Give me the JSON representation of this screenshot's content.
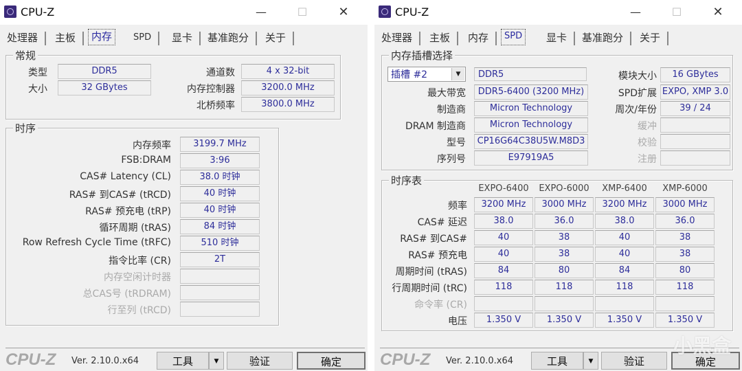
{
  "windows": [
    {
      "title": "CPU-Z",
      "controls": {
        "minimize": "—",
        "maximize": "☐",
        "close": "✕"
      },
      "tabs": [
        {
          "label": "处理器",
          "active": false
        },
        {
          "label": "主板",
          "active": false
        },
        {
          "label": "内存",
          "active": true
        },
        {
          "label": "SPD",
          "active": false
        },
        {
          "label": "显卡",
          "active": false
        },
        {
          "label": "基准跑分",
          "active": false
        },
        {
          "label": "关于",
          "active": false
        }
      ],
      "general": {
        "title": "常规",
        "type_label": "类型",
        "type_value": "DDR5",
        "size_label": "大小",
        "size_value": "32 GBytes",
        "channels_label": "通道数",
        "channels_value": "4 x 32-bit",
        "mc_label": "内存控制器",
        "mc_value": "3200.0 MHz",
        "nb_label": "北桥频率",
        "nb_value": "3800.0 MHz"
      },
      "timings": {
        "title": "时序",
        "rows": [
          {
            "label": "内存频率",
            "value": "3199.7 MHz",
            "disabled": false
          },
          {
            "label": "FSB:DRAM",
            "value": "3:96",
            "disabled": false
          },
          {
            "label": "CAS# Latency (CL)",
            "value": "38.0 时钟",
            "disabled": false
          },
          {
            "label": "RAS# 到CAS# (tRCD)",
            "value": "40 时钟",
            "disabled": false
          },
          {
            "label": "RAS# 预充电 (tRP)",
            "value": "40 时钟",
            "disabled": false
          },
          {
            "label": "循环周期 (tRAS)",
            "value": "84 时钟",
            "disabled": false
          },
          {
            "label": "Row Refresh Cycle Time (tRFC)",
            "value": "510 时钟",
            "disabled": false
          },
          {
            "label": "指令比率 (CR)",
            "value": "2T",
            "disabled": false
          },
          {
            "label": "内存空闲计时器",
            "value": "",
            "disabled": true
          },
          {
            "label": "总CAS号 (tRDRAM)",
            "value": "",
            "disabled": true
          },
          {
            "label": "行至列 (tRCD)",
            "value": "",
            "disabled": true
          }
        ]
      },
      "footer": {
        "brand": "CPU-Z",
        "version": "Ver. 2.10.0.x64",
        "tools": "工具",
        "dropdown": "▼",
        "validate": "验证",
        "ok": "确定"
      }
    },
    {
      "title": "CPU-Z",
      "controls": {
        "minimize": "—",
        "maximize": "☐",
        "close": "✕"
      },
      "tabs": [
        {
          "label": "处理器",
          "active": false
        },
        {
          "label": "主板",
          "active": false
        },
        {
          "label": "内存",
          "active": false
        },
        {
          "label": "SPD",
          "active": true
        },
        {
          "label": "显卡",
          "active": false
        },
        {
          "label": "基准跑分",
          "active": false
        },
        {
          "label": "关于",
          "active": false
        }
      ],
      "slot": {
        "title": "内存插槽选择",
        "selected_slot": "插槽 #2",
        "type_value": "DDR5",
        "module_size_label": "模块大小",
        "module_size_value": "16 GBytes",
        "max_bw_label": "最大带宽",
        "max_bw_value": "DDR5-6400 (3200 MHz)",
        "spd_ext_label": "SPD扩展",
        "spd_ext_value": "EXPO, XMP 3.0",
        "manufacturer_label": "制造商",
        "manufacturer_value": "Micron Technology",
        "week_year_label": "周次/年份",
        "week_year_value": "39 / 24",
        "dram_mfr_label": "DRAM 制造商",
        "dram_mfr_value": "Micron Technology",
        "buffered_label": "缓冲",
        "buffered_value": "",
        "part_label": "型号",
        "part_value": "CP16G64C38U5W.M8D3",
        "correction_label": "校验",
        "correction_value": "",
        "serial_label": "序列号",
        "serial_value": "E97919A5",
        "registered_label": "注册",
        "registered_value": ""
      },
      "timing_table": {
        "title": "时序表",
        "columns": [
          "EXPO-6400",
          "EXPO-6000",
          "XMP-6400",
          "XMP-6000"
        ],
        "rows": [
          {
            "label": "频率",
            "values": [
              "3200 MHz",
              "3000 MHz",
              "3200 MHz",
              "3000 MHz"
            ],
            "disabled": false
          },
          {
            "label": "CAS# 延迟",
            "values": [
              "38.0",
              "36.0",
              "38.0",
              "36.0"
            ],
            "disabled": false
          },
          {
            "label": "RAS# 到CAS#",
            "values": [
              "40",
              "38",
              "40",
              "38"
            ],
            "disabled": false
          },
          {
            "label": "RAS# 预充电",
            "values": [
              "40",
              "38",
              "40",
              "38"
            ],
            "disabled": false
          },
          {
            "label": "周期时间 (tRAS)",
            "values": [
              "84",
              "80",
              "84",
              "80"
            ],
            "disabled": false
          },
          {
            "label": "行周期时间 (tRC)",
            "values": [
              "118",
              "118",
              "118",
              "118"
            ],
            "disabled": false
          },
          {
            "label": "命令率 (CR)",
            "values": [
              "",
              "",
              "",
              ""
            ],
            "disabled": true
          },
          {
            "label": "电压",
            "values": [
              "1.350 V",
              "1.350 V",
              "1.350 V",
              "1.350 V"
            ],
            "disabled": false
          }
        ]
      },
      "footer": {
        "brand": "CPU-Z",
        "version": "Ver. 2.10.0.x64",
        "tools": "工具",
        "dropdown": "▼",
        "validate": "验证",
        "ok": "确定"
      }
    }
  ],
  "watermark": "小黑盒"
}
